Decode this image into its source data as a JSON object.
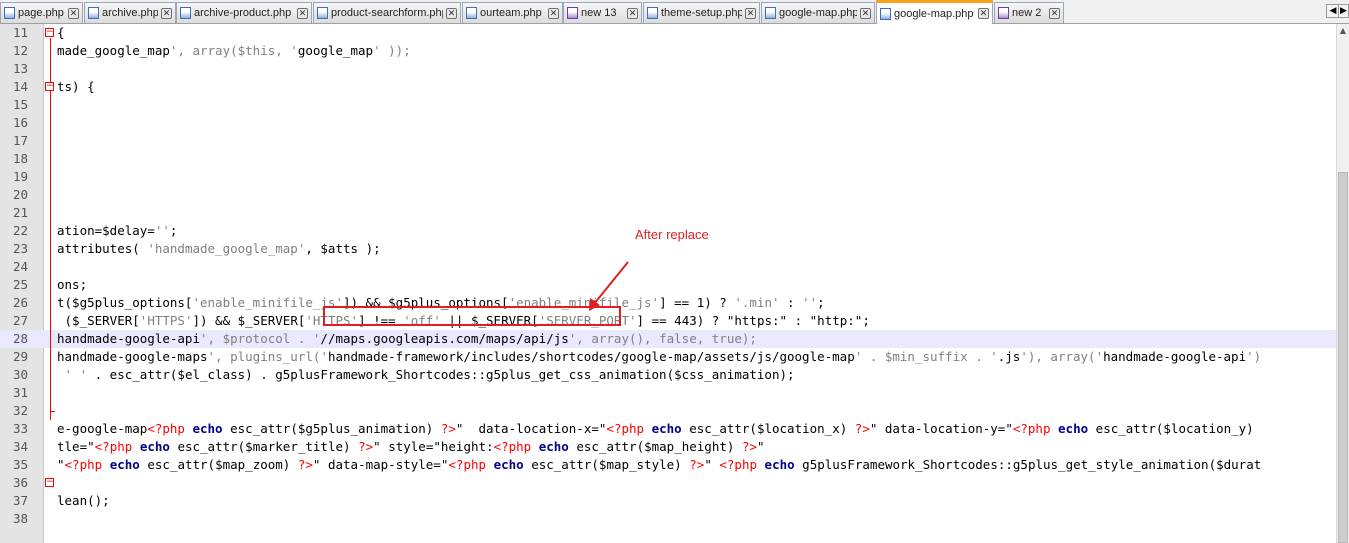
{
  "tabs": [
    {
      "label": "page.php",
      "icon": "php-file-icon",
      "active": false
    },
    {
      "label": "archive.php",
      "icon": "php-file-icon",
      "active": false
    },
    {
      "label": "archive-product.php",
      "icon": "php-file-icon",
      "active": false
    },
    {
      "label": "product-searchform.php",
      "icon": "php-file-icon",
      "active": false
    },
    {
      "label": "ourteam.php",
      "icon": "php-file-icon",
      "active": false
    },
    {
      "label": "new  13",
      "icon": "unsaved-file-icon",
      "active": false
    },
    {
      "label": "theme-setup.php",
      "icon": "php-file-icon",
      "active": false
    },
    {
      "label": "google-map.php",
      "icon": "php-file-icon",
      "active": false
    },
    {
      "label": "google-map.php",
      "icon": "php-file-icon",
      "active": true
    },
    {
      "label": "new  2",
      "icon": "unsaved-file-icon",
      "active": false
    }
  ],
  "tab_close_glyph": "✕",
  "tab_nav": {
    "prev": "◀",
    "next": "▶"
  },
  "annotation": {
    "text": "After replace",
    "color": "#e02020"
  },
  "current_line": 28,
  "lines": [
    {
      "n": "11",
      "t": "{"
    },
    {
      "n": "12",
      "t": "made_google_map', array($this, 'google_map' ));"
    },
    {
      "n": "13",
      "t": ""
    },
    {
      "n": "14",
      "t": "ts) {"
    },
    {
      "n": "15",
      "t": ""
    },
    {
      "n": "16",
      "t": ""
    },
    {
      "n": "17",
      "t": ""
    },
    {
      "n": "18",
      "t": ""
    },
    {
      "n": "19",
      "t": ""
    },
    {
      "n": "20",
      "t": ""
    },
    {
      "n": "21",
      "t": ""
    },
    {
      "n": "22",
      "t": "ation=$delay='';"
    },
    {
      "n": "23",
      "t": "attributes( 'handmade_google_map', $atts );"
    },
    {
      "n": "24",
      "t": ""
    },
    {
      "n": "25",
      "t": "ons;"
    },
    {
      "n": "26",
      "t": "t($g5plus_options['enable_minifile_js']) && $g5plus_options['enable_minifile_js'] == 1) ? '.min' : '';"
    },
    {
      "n": "27",
      "t": " ($_SERVER['HTTPS']) && $_SERVER['HTTPS'] !== 'off' || $_SERVER['SERVER_PORT'] == 443) ? \"https:\" : \"http:\";"
    },
    {
      "n": "28",
      "t": "handmade-google-api', $protocol . '//maps.googleapis.com/maps/api/js', array(), false, true);"
    },
    {
      "n": "29",
      "t": "handmade-google-maps', plugins_url('handmade-framework/includes/shortcodes/google-map/assets/js/google-map' . $min_suffix . '.js'), array('handmade-google-api')"
    },
    {
      "n": "30",
      "t": " ' ' . esc_attr($el_class) . g5plusFramework_Shortcodes::g5plus_get_css_animation($css_animation);"
    },
    {
      "n": "31",
      "t": ""
    },
    {
      "n": "32",
      "t": ""
    },
    {
      "n": "33",
      "t": "e-google-map<?php echo esc_attr($g5plus_animation) ?>\"  data-location-x=\"<?php echo esc_attr($location_x) ?>\" data-location-y=\"<?php echo esc_attr($location_y)"
    },
    {
      "n": "34",
      "t": "tle=\"<?php echo esc_attr($marker_title) ?>\" style=\"height:<?php echo esc_attr($map_height) ?>\""
    },
    {
      "n": "35",
      "t": "\"<?php echo esc_attr($map_zoom) ?>\" data-map-style=\"<?php echo esc_attr($map_style) ?>\" <?php echo g5plusFramework_Shortcodes::g5plus_get_style_animation($durat"
    },
    {
      "n": "36",
      "t": ""
    },
    {
      "n": "37",
      "t": "lean();"
    },
    {
      "n": "38",
      "t": ""
    }
  ]
}
